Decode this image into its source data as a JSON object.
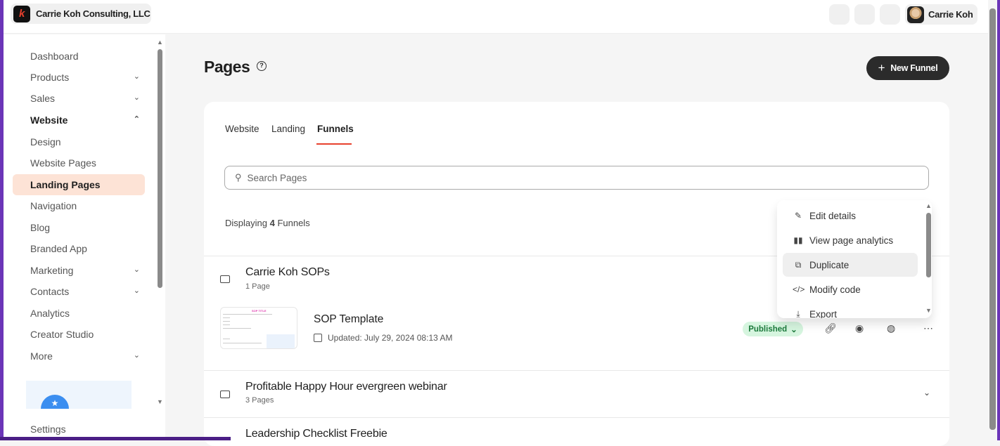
{
  "header": {
    "org_name": "Carrie Koh Consulting, LLC",
    "logo_letter": "k",
    "user_name": "Carrie Koh"
  },
  "sidebar": {
    "items": [
      {
        "label": "Dashboard"
      },
      {
        "label": "Products",
        "chev": "⌄"
      },
      {
        "label": "Sales",
        "chev": "⌄"
      },
      {
        "label": "Website",
        "chev": "⌃"
      },
      {
        "label": "Design"
      },
      {
        "label": "Website Pages"
      },
      {
        "label": "Landing Pages"
      },
      {
        "label": "Navigation"
      },
      {
        "label": "Blog"
      },
      {
        "label": "Branded App"
      },
      {
        "label": "Marketing",
        "chev": "⌄"
      },
      {
        "label": "Contacts",
        "chev": "⌄"
      },
      {
        "label": "Analytics"
      },
      {
        "label": "Creator Studio"
      },
      {
        "label": "More",
        "chev": "⌄"
      }
    ],
    "settings": "Settings"
  },
  "page": {
    "title": "Pages",
    "help": "?",
    "new_button": "New Funnel",
    "plus": "+"
  },
  "tabs": [
    "Website",
    "Landing",
    "Funnels"
  ],
  "search": {
    "placeholder": "Search Pages"
  },
  "count": {
    "prefix": "Displaying ",
    "num": "4",
    "suffix": " Funnels"
  },
  "funnels": [
    {
      "title": "Carrie Koh SOPs",
      "sub": "1 Page"
    },
    {
      "title": "Profitable Happy Hour evergreen webinar",
      "sub": "3 Pages"
    },
    {
      "title": "Leadership Checklist Freebie"
    }
  ],
  "page_row": {
    "title": "SOP Template",
    "updated": "Updated: July 29, 2024 08:13 AM",
    "status": "Published",
    "thumb_title": "SOP TITLE"
  },
  "menu": [
    {
      "label": "Edit details",
      "icon": "✎"
    },
    {
      "label": "View page analytics",
      "icon": "▮▮"
    },
    {
      "label": "Duplicate",
      "icon": "⧉"
    },
    {
      "label": "Modify code",
      "icon": "</>"
    },
    {
      "label": "Export",
      "icon": "⤓"
    }
  ],
  "colors": {
    "accent": "#e8412e",
    "window_border": "#6b35b8",
    "published_bg": "#d6f5df"
  }
}
